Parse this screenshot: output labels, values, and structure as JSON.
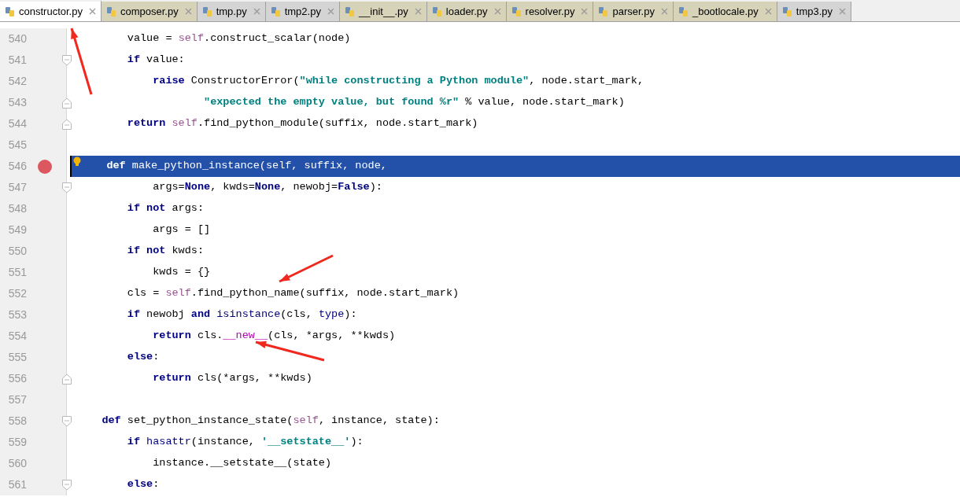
{
  "tabs": [
    {
      "label": "constructor.py",
      "selected": true,
      "color": "#ffffff"
    },
    {
      "label": "composer.py",
      "selected": false,
      "color": "#d6d3b9"
    },
    {
      "label": "tmp.py",
      "selected": false,
      "color": "#d4d4d4"
    },
    {
      "label": "tmp2.py",
      "selected": false,
      "color": "#d4d4d4"
    },
    {
      "label": "__init__.py",
      "selected": false,
      "color": "#d6d3b9"
    },
    {
      "label": "loader.py",
      "selected": false,
      "color": "#d6d3b9"
    },
    {
      "label": "resolver.py",
      "selected": false,
      "color": "#d6d3b9"
    },
    {
      "label": "parser.py",
      "selected": false,
      "color": "#d6d3b9"
    },
    {
      "label": "_bootlocale.py",
      "selected": false,
      "color": "#d6d3b9"
    },
    {
      "label": "tmp3.py",
      "selected": false,
      "color": "#d4d4d4"
    }
  ],
  "editor": {
    "lines": [
      {
        "number": "540",
        "fold_start": false,
        "fold_end": false,
        "breakpoint": false,
        "highlighted": false,
        "tokens": [
          {
            "kind": "plain",
            "text": "        value = "
          },
          {
            "kind": "self",
            "text": "self"
          },
          {
            "kind": "plain",
            "text": ".construct_scalar(node)"
          }
        ]
      },
      {
        "number": "541",
        "fold_start": true,
        "fold_end": false,
        "breakpoint": false,
        "highlighted": false,
        "tokens": [
          {
            "kind": "keyword",
            "text": "        if"
          },
          {
            "kind": "plain",
            "text": " value:"
          }
        ]
      },
      {
        "number": "542",
        "fold_start": false,
        "fold_end": false,
        "breakpoint": false,
        "highlighted": false,
        "tokens": [
          {
            "kind": "keyword",
            "text": "            raise"
          },
          {
            "kind": "plain",
            "text": " ConstructorError("
          },
          {
            "kind": "string",
            "text": "\"while constructing a Python module\""
          },
          {
            "kind": "plain",
            "text": ", node.start_mark,"
          }
        ]
      },
      {
        "number": "543",
        "fold_start": false,
        "fold_end": true,
        "breakpoint": false,
        "highlighted": false,
        "tokens": [
          {
            "kind": "string",
            "text": "                    \"expected the empty value, but found %r\""
          },
          {
            "kind": "plain",
            "text": " % value, node.start_mark)"
          }
        ]
      },
      {
        "number": "544",
        "fold_start": false,
        "fold_end": true,
        "breakpoint": false,
        "highlighted": false,
        "tokens": [
          {
            "kind": "keyword",
            "text": "        return"
          },
          {
            "kind": "self",
            "text": " self"
          },
          {
            "kind": "plain",
            "text": ".find_python_module(suffix, node.start_mark)"
          }
        ]
      },
      {
        "number": "545",
        "fold_start": false,
        "fold_end": false,
        "breakpoint": false,
        "highlighted": false
      },
      {
        "number": "546",
        "fold_start": false,
        "fold_end": false,
        "breakpoint": true,
        "highlighted": true,
        "tokens": [
          {
            "kind": "keyword",
            "text": "    def"
          },
          {
            "kind": "plain",
            "text": " make_python_instance(self, suffix, node,"
          }
        ]
      },
      {
        "number": "547",
        "fold_start": true,
        "fold_end": false,
        "breakpoint": false,
        "highlighted": false,
        "tokens": [
          {
            "kind": "plain",
            "text": "            args="
          },
          {
            "kind": "keyword",
            "text": "None"
          },
          {
            "kind": "plain",
            "text": ", kwds="
          },
          {
            "kind": "keyword",
            "text": "None"
          },
          {
            "kind": "plain",
            "text": ", newobj="
          },
          {
            "kind": "keyword",
            "text": "False"
          },
          {
            "kind": "plain",
            "text": "):"
          }
        ]
      },
      {
        "number": "548",
        "fold_start": false,
        "fold_end": false,
        "breakpoint": false,
        "highlighted": false,
        "tokens": [
          {
            "kind": "keyword",
            "text": "        if not"
          },
          {
            "kind": "plain",
            "text": " args:"
          }
        ]
      },
      {
        "number": "549",
        "fold_start": false,
        "fold_end": false,
        "breakpoint": false,
        "highlighted": false,
        "tokens": [
          {
            "kind": "plain",
            "text": "            args = []"
          }
        ]
      },
      {
        "number": "550",
        "fold_start": false,
        "fold_end": false,
        "breakpoint": false,
        "highlighted": false,
        "tokens": [
          {
            "kind": "keyword",
            "text": "        if not"
          },
          {
            "kind": "plain",
            "text": " kwds:"
          }
        ]
      },
      {
        "number": "551",
        "fold_start": false,
        "fold_end": false,
        "breakpoint": false,
        "highlighted": false,
        "tokens": [
          {
            "kind": "plain",
            "text": "            kwds = {}"
          }
        ]
      },
      {
        "number": "552",
        "fold_start": false,
        "fold_end": false,
        "breakpoint": false,
        "highlighted": false,
        "tokens": [
          {
            "kind": "plain",
            "text": "        cls = "
          },
          {
            "kind": "self",
            "text": "self"
          },
          {
            "kind": "plain",
            "text": ".find_python_name(suffix, node.start_mark)"
          }
        ]
      },
      {
        "number": "553",
        "fold_start": false,
        "fold_end": false,
        "breakpoint": false,
        "highlighted": false,
        "tokens": [
          {
            "kind": "keyword",
            "text": "        if"
          },
          {
            "kind": "plain",
            "text": " newobj "
          },
          {
            "kind": "keyword",
            "text": "and"
          },
          {
            "kind": "builtin",
            "text": " isinstance"
          },
          {
            "kind": "plain",
            "text": "(cls, "
          },
          {
            "kind": "builtin",
            "text": "type"
          },
          {
            "kind": "plain",
            "text": "):"
          }
        ]
      },
      {
        "number": "554",
        "fold_start": false,
        "fold_end": false,
        "breakpoint": false,
        "highlighted": false,
        "tokens": [
          {
            "kind": "keyword",
            "text": "            return"
          },
          {
            "kind": "plain",
            "text": " cls."
          },
          {
            "kind": "magic",
            "text": "__new__"
          },
          {
            "kind": "plain",
            "text": "(cls, *args, **kwds)"
          }
        ]
      },
      {
        "number": "555",
        "fold_start": false,
        "fold_end": false,
        "breakpoint": false,
        "highlighted": false,
        "tokens": [
          {
            "kind": "keyword",
            "text": "        else"
          },
          {
            "kind": "plain",
            "text": ":"
          }
        ]
      },
      {
        "number": "556",
        "fold_start": false,
        "fold_end": true,
        "breakpoint": false,
        "highlighted": false,
        "tokens": [
          {
            "kind": "keyword",
            "text": "            return"
          },
          {
            "kind": "plain",
            "text": " cls(*args, **kwds)"
          }
        ]
      },
      {
        "number": "557",
        "fold_start": false,
        "fold_end": false,
        "breakpoint": false,
        "highlighted": false
      },
      {
        "number": "558",
        "fold_start": true,
        "fold_end": false,
        "breakpoint": false,
        "highlighted": false,
        "tokens": [
          {
            "kind": "keyword",
            "text": "    def"
          },
          {
            "kind": "plain",
            "text": " set_python_instance_state("
          },
          {
            "kind": "self",
            "text": "self"
          },
          {
            "kind": "plain",
            "text": ", instance, state):"
          }
        ]
      },
      {
        "number": "559",
        "fold_start": false,
        "fold_end": false,
        "breakpoint": false,
        "highlighted": false,
        "tokens": [
          {
            "kind": "keyword",
            "text": "        if"
          },
          {
            "kind": "builtin",
            "text": " hasattr"
          },
          {
            "kind": "plain",
            "text": "(instance, "
          },
          {
            "kind": "string",
            "text": "'__setstate__'"
          },
          {
            "kind": "plain",
            "text": "):"
          }
        ]
      },
      {
        "number": "560",
        "fold_start": false,
        "fold_end": false,
        "breakpoint": false,
        "highlighted": false,
        "tokens": [
          {
            "kind": "plain",
            "text": "            instance.__setstate__(state)"
          }
        ]
      },
      {
        "number": "561",
        "fold_start": true,
        "fold_end": false,
        "breakpoint": false,
        "highlighted": false,
        "tokens": [
          {
            "kind": "keyword",
            "text": "        else"
          },
          {
            "kind": "plain",
            "text": ":"
          }
        ]
      }
    ]
  }
}
